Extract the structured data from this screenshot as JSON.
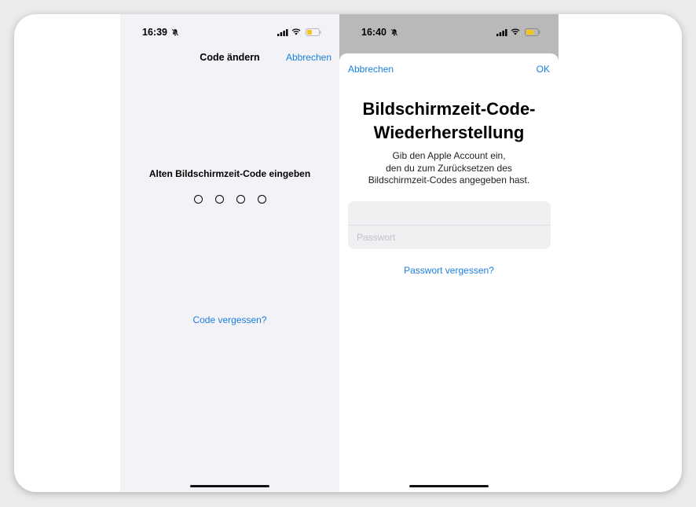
{
  "left_screen": {
    "status": {
      "time": "16:39"
    },
    "nav": {
      "title": "Code ändern",
      "cancel_label": "Abbrechen"
    },
    "prompt": "Alten Bildschirmzeit-Code eingeben",
    "passcode_length": 4,
    "forgot_code_label": "Code vergessen?"
  },
  "right_screen": {
    "status": {
      "time": "16:40"
    },
    "sheet": {
      "cancel_label": "Abbrechen",
      "ok_label": "OK",
      "title_line1": "Bildschirmzeit-Code-",
      "title_line2": "Wiederherstellung",
      "desc_line1": "Gib den Apple Account ein,",
      "desc_line2": "den du zum Zurücksetzen des",
      "desc_line3": "Bildschirmzeit-Codes angegeben hast.",
      "password_placeholder": "Passwort",
      "forgot_password_label": "Passwort vergessen?"
    }
  },
  "colors": {
    "accent": "#1a7fe0",
    "battery": "#f5c518"
  },
  "icons": [
    "bell-slash-icon",
    "cellular-signal-icon",
    "wifi-icon",
    "battery-icon"
  ]
}
